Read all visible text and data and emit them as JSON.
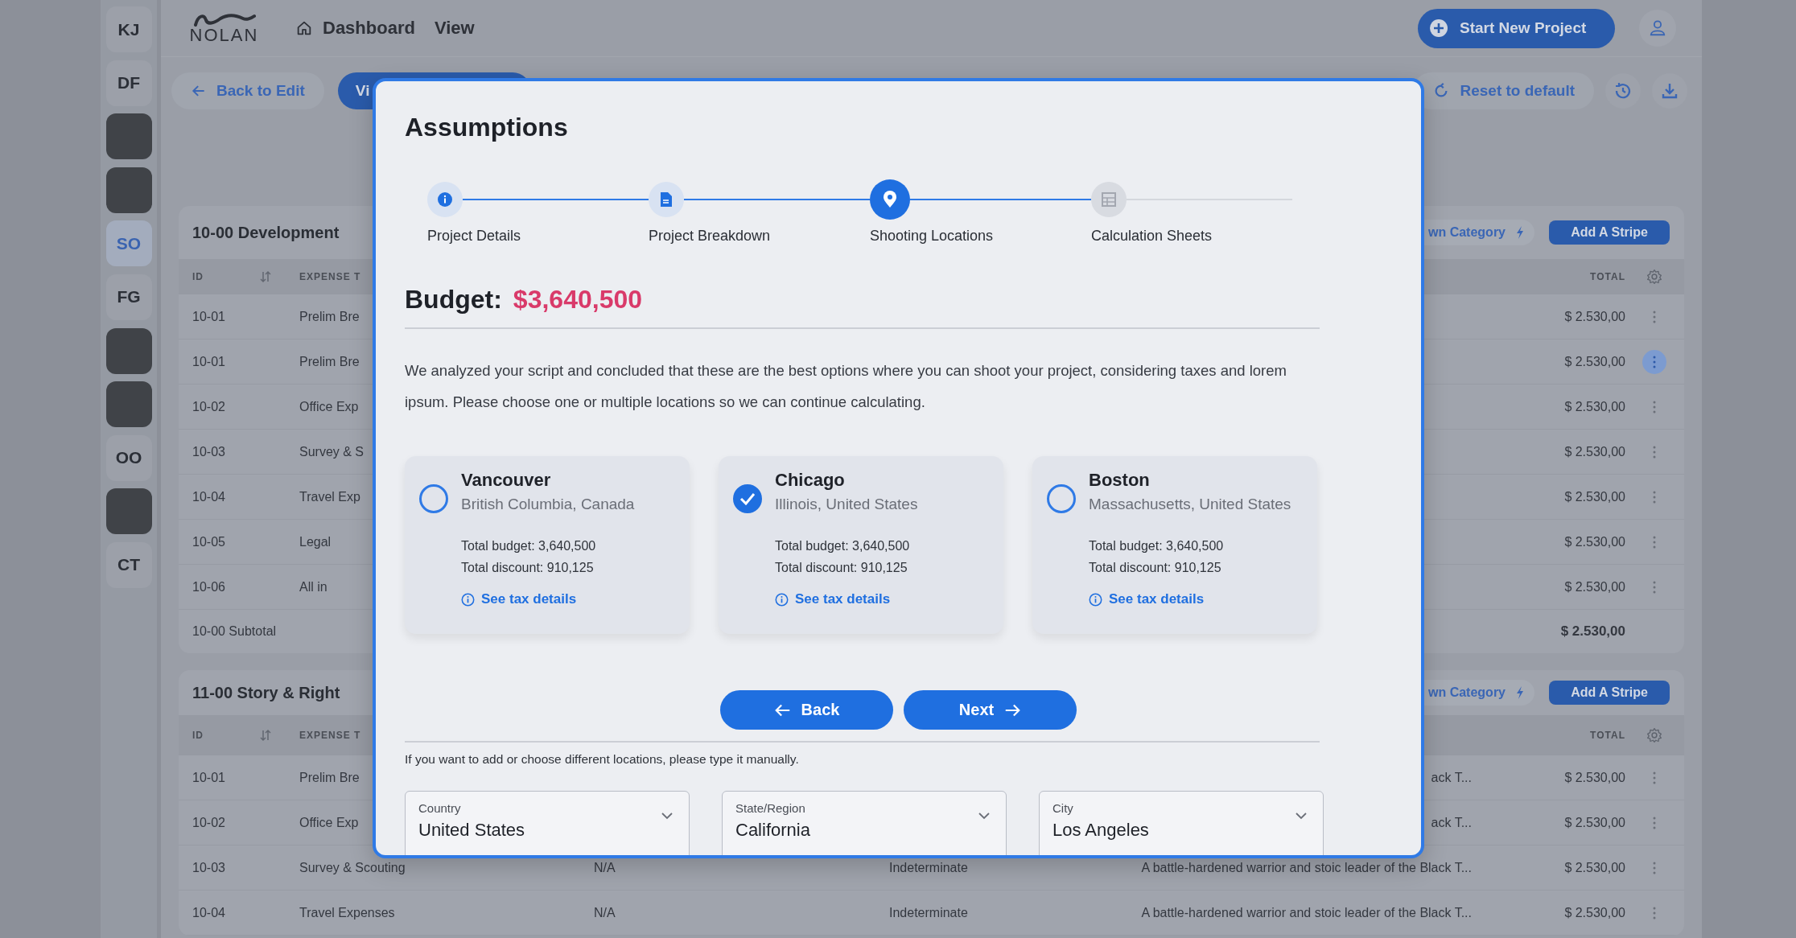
{
  "sidebar": {
    "items": [
      {
        "kind": "initials",
        "label": "KJ",
        "selected": false
      },
      {
        "kind": "initials",
        "label": "DF",
        "selected": false
      },
      {
        "kind": "photo",
        "selected": false
      },
      {
        "kind": "photo",
        "selected": false
      },
      {
        "kind": "initials",
        "label": "SO",
        "selected": true
      },
      {
        "kind": "initials",
        "label": "FG",
        "selected": false
      },
      {
        "kind": "photo",
        "selected": false
      },
      {
        "kind": "photo",
        "selected": false
      },
      {
        "kind": "initials",
        "label": "OO",
        "selected": false
      },
      {
        "kind": "photo",
        "selected": false
      },
      {
        "kind": "initials",
        "label": "CT",
        "selected": false
      }
    ]
  },
  "topbar": {
    "logo": "NOLAN",
    "home_link": "Dashboard",
    "view_link": "View",
    "start_button": "Start New Project"
  },
  "toolbar": {
    "back_button": "Back to Edit",
    "view_button": "Vi",
    "reset_button": "Reset to default"
  },
  "sections": [
    {
      "title": "10-00 Development",
      "category_button": "wn Category",
      "add_button": "Add A Stripe",
      "columns": {
        "id": "ID",
        "expense": "EXPENSE T",
        "total": "TOTAL"
      },
      "rows": [
        {
          "id": "10-01",
          "expense": "Prelim Bre",
          "total": "$ 2.530,00",
          "menu_active": false
        },
        {
          "id": "10-01",
          "expense": "Prelim Bre",
          "total": "$ 2.530,00",
          "menu_active": true
        },
        {
          "id": "10-02",
          "expense": "Office Exp",
          "total": "$ 2.530,00",
          "menu_active": false
        },
        {
          "id": "10-03",
          "expense": "Survey & S",
          "total": "$ 2.530,00",
          "menu_active": false
        },
        {
          "id": "10-04",
          "expense": "Travel Exp",
          "total": "$ 2.530,00",
          "menu_active": false
        },
        {
          "id": "10-05",
          "expense": "Legal",
          "total": "$ 2.530,00",
          "menu_active": false
        },
        {
          "id": "10-06",
          "expense": "All in",
          "total": "$ 2.530,00",
          "menu_active": false
        }
      ],
      "subtotal": {
        "label": "10-00 Subtotal",
        "total": "$ 2.530,00"
      }
    },
    {
      "title": "11-00 Story & Right",
      "category_button": "wn Category",
      "add_button": "Add A Stripe",
      "columns": {
        "id": "ID",
        "expense": "EXPENSE T",
        "total": "TOTAL"
      },
      "rows": [
        {
          "id": "10-01",
          "expense": "Prelim Bre",
          "description": "ack T...",
          "total": "$ 2.530,00",
          "menu_active": false
        },
        {
          "id": "10-02",
          "expense": "Office Exp",
          "description": "ack T...",
          "total": "$ 2.530,00",
          "menu_active": false
        },
        {
          "id": "10-03",
          "expense": "Survey & Scouting",
          "column_3": "N/A",
          "column_4": "Indeterminate",
          "description": "A battle-hardened warrior and stoic leader of the Black T...",
          "total": "$ 2.530,00",
          "menu_active": false
        },
        {
          "id": "10-04",
          "expense": "Travel Expenses",
          "column_3": "N/A",
          "column_4": "Indeterminate",
          "description": "A battle-hardened warrior and stoic leader of the Black T...",
          "total": "$ 2.530,00",
          "menu_active": false
        }
      ]
    }
  ],
  "modal": {
    "title": "Assumptions",
    "steps": [
      {
        "label": "Project Details",
        "completed": true,
        "selected": false
      },
      {
        "label": "Project Breakdown",
        "completed": true,
        "selected": false
      },
      {
        "label": "Shooting Locations",
        "completed": false,
        "selected": true
      },
      {
        "label": "Calculation Sheets",
        "completed": false,
        "selected": false
      }
    ],
    "budget_label": "Budget:",
    "budget_value": "$3,640,500",
    "intro": "We analyzed your script and concluded that these are the best options where you can shoot your project, considering taxes and lorem ipsum. Please choose one or multiple locations so we can continue calculating.",
    "locations": [
      {
        "city": "Vancouver",
        "region": "British Columbia, Canada",
        "total_budget": "Total budget: 3,640,500",
        "total_discount": "Total discount: 910,125",
        "link": "See tax details",
        "selected": false
      },
      {
        "city": "Chicago",
        "region": "Illinois, United States",
        "total_budget": "Total budget: 3,640,500",
        "total_discount": "Total discount: 910,125",
        "link": "See tax details",
        "selected": true
      },
      {
        "city": "Boston",
        "region": "Massachusetts, United States",
        "total_budget": "Total budget: 3,640,500",
        "total_discount": "Total discount: 910,125",
        "link": "See tax details",
        "selected": false
      }
    ],
    "back_button": "Back",
    "next_button": "Next",
    "hint": "If you want to add or choose different locations, please type it manually.",
    "fields": [
      {
        "label": "Country",
        "value": "United States"
      },
      {
        "label": "State/Region",
        "value": "California"
      },
      {
        "label": "City",
        "value": "Los Angeles"
      }
    ]
  }
}
